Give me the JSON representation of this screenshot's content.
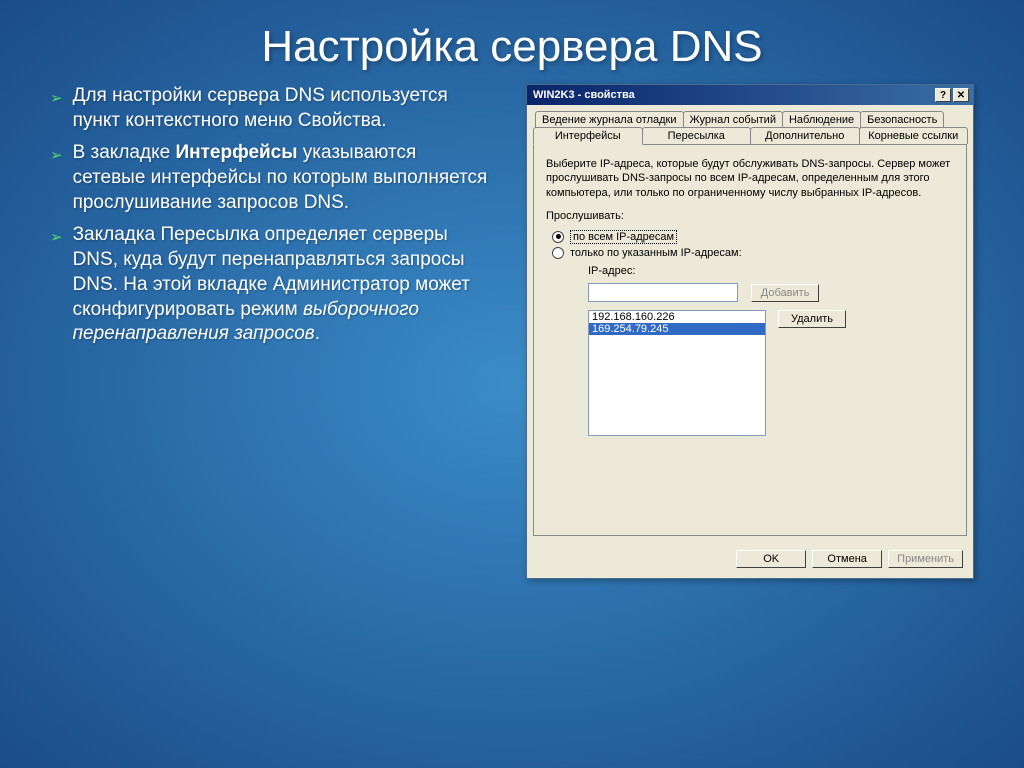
{
  "slide": {
    "title": "Настройка сервера DNS",
    "bullets": [
      {
        "pre": "Для настройки сервера DNS используется пункт контекстного меню Свойства."
      },
      {
        "pre": "В закладке ",
        "bold": "Интерфейсы",
        "post": " указываются сетевые интерфейсы по которым выполняется прослушивание запросов DNS."
      },
      {
        "pre": "Закладка Пересылка определяет серверы DNS, куда будут перенаправляться запросы DNS. На этой вкладке Администратор может сконфигурировать режим ",
        "italic": "выборочного перенаправления запросов",
        "post2": "."
      }
    ]
  },
  "dialog": {
    "title": "WIN2K3 - свойства",
    "help_icon": "?",
    "close_icon": "✕",
    "tabs_row1": [
      "Ведение журнала отладки",
      "Журнал событий",
      "Наблюдение",
      "Безопасность"
    ],
    "tabs_row2": [
      "Интерфейсы",
      "Пересылка",
      "Дополнительно",
      "Корневые ссылки"
    ],
    "active_tab": "Интерфейсы",
    "description": "Выберите IP-адреса, которые будут обслуживать DNS-запросы. Сервер может прослушивать DNS-запросы по всем IP-адресам, определенным для этого компьютера, или только по ограниченному числу выбранных IP-адресов.",
    "listen_label": "Прослушивать:",
    "radio_all": "по всем IP-адресам",
    "radio_specified": "только по указанным IP-адресам:",
    "ip_label": "IP-адрес:",
    "btn_add": "Добавить",
    "btn_remove": "Удалить",
    "ip_list": [
      "192.168.160.226",
      "169.254.79.245"
    ],
    "btn_ok": "OK",
    "btn_cancel": "Отмена",
    "btn_apply": "Применить"
  }
}
